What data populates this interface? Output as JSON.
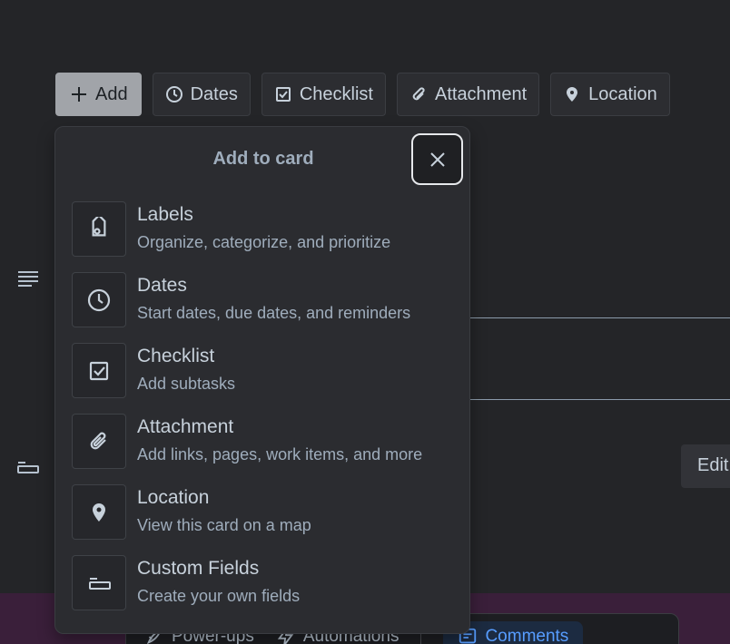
{
  "toolbar": {
    "add_label": "Add",
    "dates_label": "Dates",
    "checklist_label": "Checklist",
    "attachment_label": "Attachment",
    "location_label": "Location"
  },
  "popover": {
    "title": "Add to card",
    "items": [
      {
        "name": "Labels",
        "description": "Organize, categorize, and prioritize",
        "icon": "label-icon"
      },
      {
        "name": "Dates",
        "description": "Start dates, due dates, and reminders",
        "icon": "clock-icon"
      },
      {
        "name": "Checklist",
        "description": "Add subtasks",
        "icon": "checkbox-icon"
      },
      {
        "name": "Attachment",
        "description": "Add links, pages, work items, and more",
        "icon": "paperclip-icon"
      },
      {
        "name": "Location",
        "description": "View this card on a map",
        "icon": "map-pin-icon"
      },
      {
        "name": "Custom Fields",
        "description": "Create your own fields",
        "icon": "custom-field-icon"
      }
    ]
  },
  "side": {
    "edit_label": "Edit"
  },
  "bottom_bar": {
    "powerups_label": "Power-ups",
    "automations_label": "Automations",
    "comments_label": "Comments"
  },
  "colors": {
    "background": "#242528",
    "popover": "#2b2c30",
    "add_button": "#a1a4a9",
    "accent": "#579dff"
  }
}
